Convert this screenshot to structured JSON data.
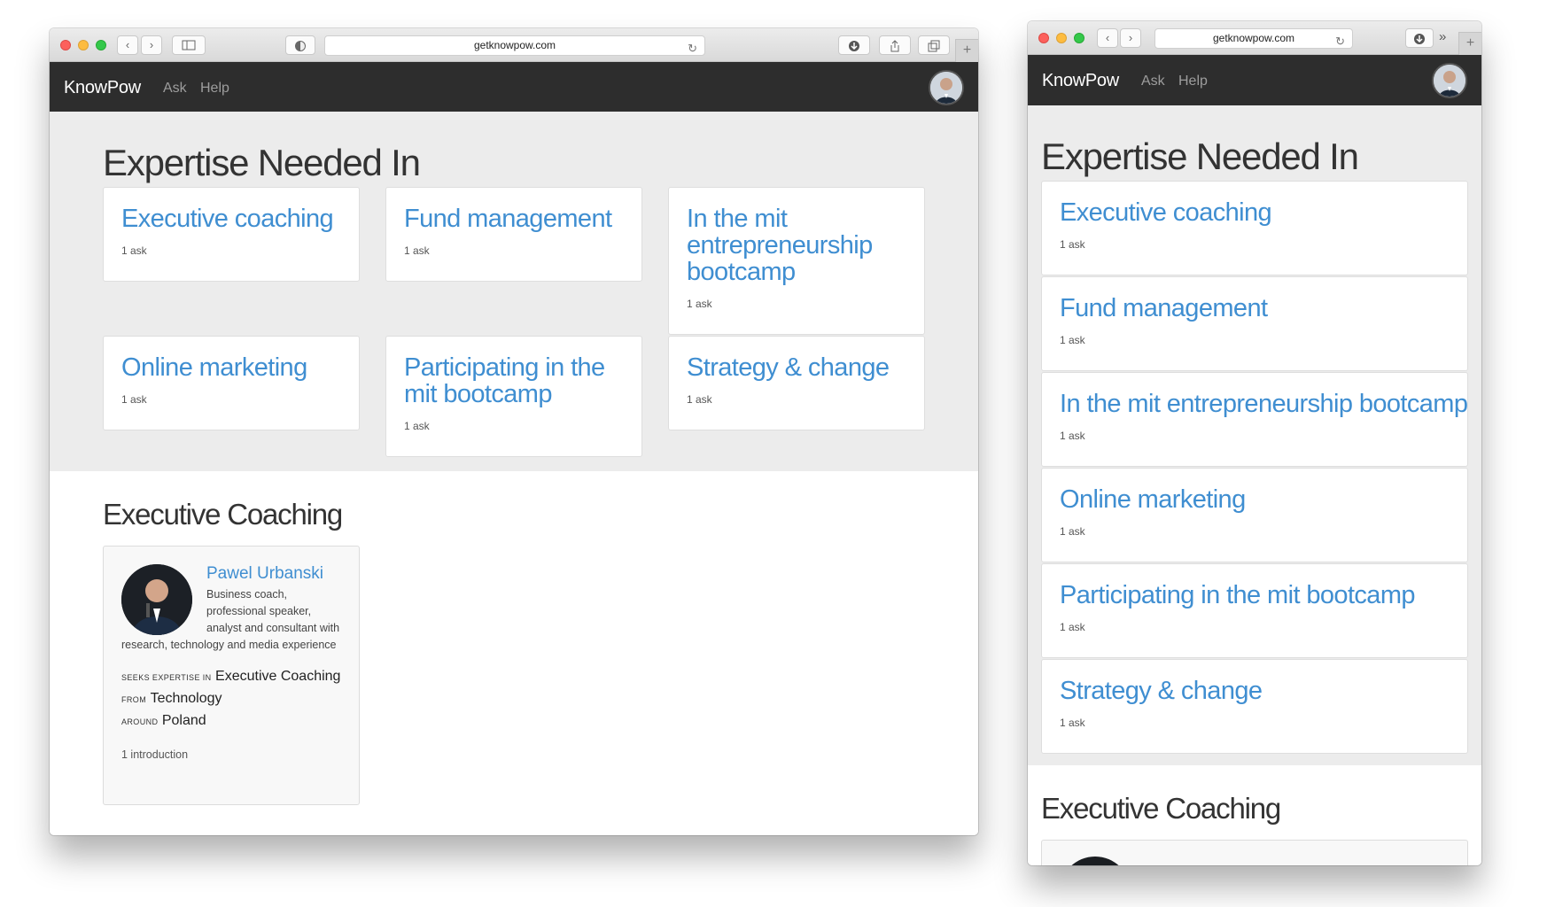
{
  "browser": {
    "url": "getknowpow.com"
  },
  "navbar": {
    "brand": "KnowPow",
    "links": [
      "Ask",
      "Help"
    ]
  },
  "expertise": {
    "heading": "Expertise Needed In",
    "cards": [
      {
        "title": "Executive coaching",
        "count": "1 ask"
      },
      {
        "title": "Fund management",
        "count": "1 ask"
      },
      {
        "title": "In the mit entrepreneurship bootcamp",
        "count": "1 ask"
      },
      {
        "title": "Online marketing",
        "count": "1 ask"
      },
      {
        "title": "Participating in the mit bootcamp",
        "count": "1 ask"
      },
      {
        "title": "Strategy & change",
        "count": "1 ask"
      }
    ]
  },
  "executive": {
    "heading": "Executive Coaching",
    "person": {
      "name": "Pawel Urbanski",
      "bio": "Business coach, professional speaker, analyst and consultant with research, technology and media experience",
      "seeks_label": "SEEKS EXPERTISE IN",
      "seeks_value": "Executive Coaching",
      "from_label": "FROM",
      "from_value": "Technology",
      "around_label": "AROUND",
      "around_value": "Poland",
      "introductions": "1 introduction"
    }
  },
  "colors": {
    "accent": "#3f8ed1",
    "navbar": "#2d2d2d",
    "section": "#ececec"
  }
}
